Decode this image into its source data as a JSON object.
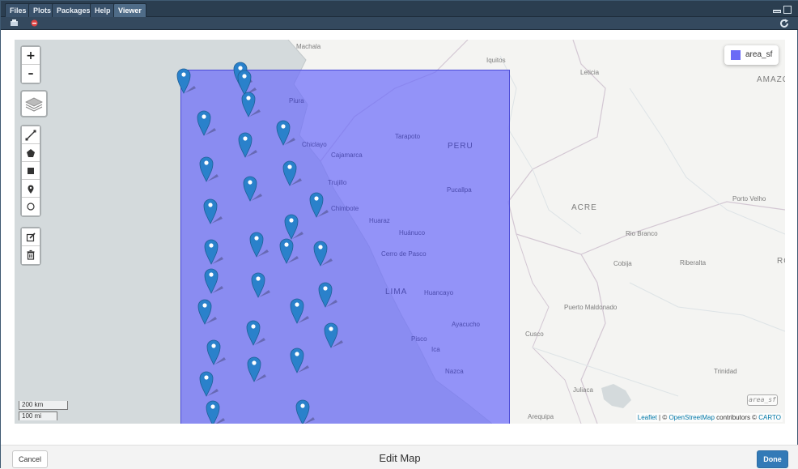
{
  "tabs": [
    {
      "label": "Files"
    },
    {
      "label": "Plots"
    },
    {
      "label": "Packages"
    },
    {
      "label": "Help"
    },
    {
      "label": "Viewer"
    }
  ],
  "active_tab": "Viewer",
  "map": {
    "zoom_in": "+",
    "zoom_out": "–",
    "legend_label": "area_sf",
    "legend_color": "#6b6bf6",
    "area_color": "#6e6efa",
    "marker_color": "#2a81cb",
    "scale_km": "200 km",
    "scale_mi": "100 mi",
    "layer_tag": "area_sf",
    "marker_count": 33,
    "draw_tools": [
      "polyline-icon",
      "polygon-icon",
      "rectangle-icon",
      "marker-icon",
      "circle-icon"
    ],
    "edit_tools": [
      "edit-icon",
      "trash-icon"
    ],
    "attribution": {
      "leaflet": "Leaflet",
      "sep": " | © ",
      "osm": "OpenStreetMap",
      "contrib": " contributors © ",
      "carto": "CARTO"
    },
    "places": {
      "machala": "Machala",
      "iquitos": "Iquitos",
      "leticia": "Leticia",
      "amazo": "AMAZO",
      "piura": "Piura",
      "tarapoto": "Tarapoto",
      "peru": "PERU",
      "chiclayo": "Chiclayo",
      "cajamarca": "Cajamarca",
      "trujillo": "Trujillo",
      "pucallpa": "Pucallpa",
      "acre": "ACRE",
      "porto_velho": "Porto Velho",
      "chimbote": "Chimbote",
      "huaraz": "Huaraz",
      "huanuco": "Huánuco",
      "rio_branco": "Rio Branco",
      "cerro_de_pasco": "Cerro de Pasco",
      "cobija": "Cobija",
      "riberalta": "Riberalta",
      "ro": "RO",
      "lima": "LIMA",
      "huancayo": "Huancayo",
      "puerto_maldonado": "Puerto Maldonado",
      "ayacucho": "Ayacucho",
      "cusco": "Cusco",
      "pisco": "Pisco",
      "ica": "Ica",
      "trinidad": "Trinidad",
      "nazca": "Nazca",
      "juliaca": "Juliaca",
      "arequipa": "Arequipa"
    }
  },
  "bottom": {
    "cancel": "Cancel",
    "title": "Edit Map",
    "done": "Done"
  }
}
